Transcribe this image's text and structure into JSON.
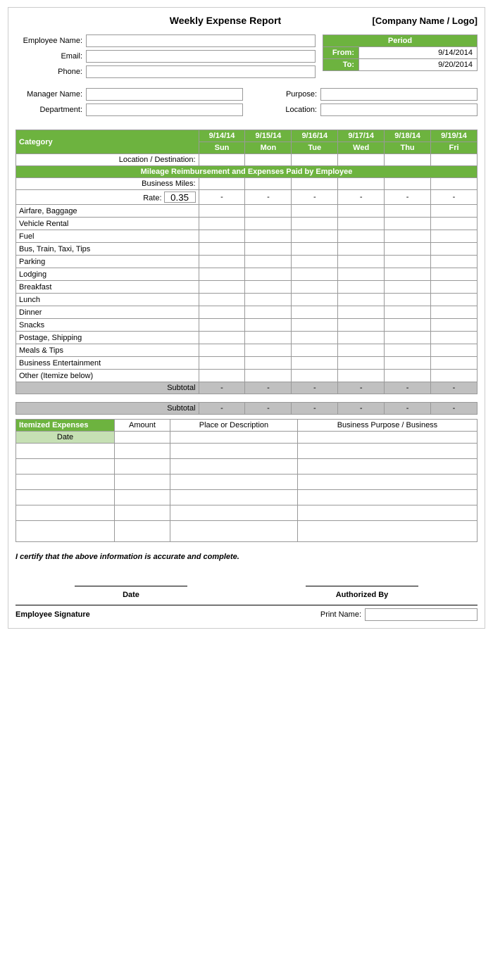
{
  "title": "Weekly Expense Report",
  "company": "[Company Name / Logo]",
  "fields": {
    "employee_name_label": "Employee Name:",
    "email_label": "Email:",
    "phone_label": "Phone:",
    "manager_name_label": "Manager Name:",
    "department_label": "Department:",
    "purpose_label": "Purpose:",
    "location_label": "Location:"
  },
  "period": {
    "header": "Period",
    "from_label": "From:",
    "from_value": "9/14/2014",
    "to_label": "To:",
    "to_value": "9/20/2014"
  },
  "dates": {
    "cols": [
      "9/14/14",
      "9/15/14",
      "9/16/14",
      "9/17/14",
      "9/18/14",
      "9/19/14"
    ],
    "days": [
      "Sun",
      "Mon",
      "Tue",
      "Wed",
      "Thu",
      "Fri"
    ]
  },
  "table": {
    "category_label": "Category",
    "location_destination": "Location / Destination:",
    "mileage_section": "Mileage Reimbursement and Expenses Paid by Employee",
    "business_miles_label": "Business Miles:",
    "rate_label": "Rate:",
    "rate_value": "0.35",
    "rows": [
      "Airfare, Baggage",
      "Vehicle Rental",
      "Fuel",
      "Bus, Train, Taxi, Tips",
      "Parking",
      "Lodging",
      "Breakfast",
      "Lunch",
      "Dinner",
      "Snacks",
      "Postage, Shipping",
      "Meals & Tips",
      "Business Entertainment",
      "Other (Itemize below)"
    ],
    "subtotal_label": "Subtotal",
    "dash": "-"
  },
  "itemized": {
    "header": "Itemized Expenses",
    "amount_col": "Amount",
    "place_col": "Place or Description",
    "business_col": "Business Purpose / Business",
    "date_col": "Date"
  },
  "certify_text": "I certify that the above information is accurate and complete.",
  "signature": {
    "date_label": "Date",
    "authorized_label": "Authorized By",
    "employee_sig_label": "Employee Signature",
    "print_name_label": "Print Name:"
  }
}
